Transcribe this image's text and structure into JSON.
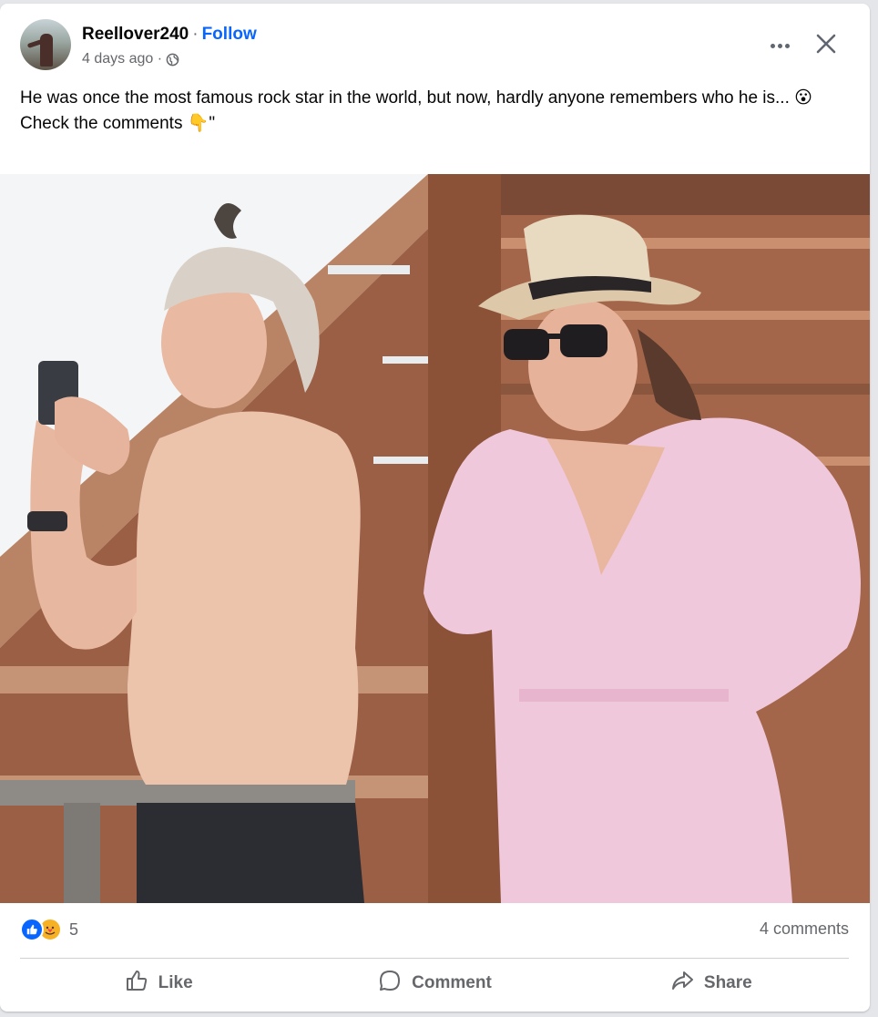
{
  "post": {
    "author": "Reellover240",
    "separator": "·",
    "follow_label": "Follow",
    "timestamp": "4 days ago ·",
    "audience_icon": "globe-icon",
    "text_line1": "He was once the most famous rock star in the world, but now, hardly anyone remembers who he is... 😮",
    "text_line2": "Check the comments 👇\""
  },
  "stats": {
    "reactions": [
      "like",
      "care"
    ],
    "reaction_count": "5",
    "comments": "4 comments"
  },
  "actions": {
    "like_label": "Like",
    "comment_label": "Comment",
    "share_label": "Share"
  },
  "colors": {
    "follow": "#0866ff",
    "secondary_text": "#65676b",
    "dress": "#f0c8dc",
    "hat": "#e8d9c1",
    "wood": "#a36a4b"
  }
}
